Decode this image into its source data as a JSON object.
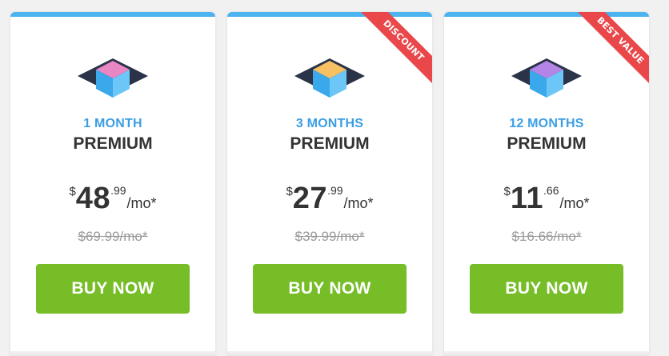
{
  "colors": {
    "accent_blue": "#4bb3ef",
    "months_text": "#3a9ee4",
    "ribbon_red": "#e9474a",
    "button_green": "#77bd28",
    "text_dark": "#333333",
    "text_muted": "#9a9a9a"
  },
  "plans": [
    {
      "months_label": "1 MONTH",
      "name": "PREMIUM",
      "currency": "$",
      "price_whole": "48",
      "price_cents": ".99",
      "per": "/mo*",
      "old_price": "$69.99/mo*",
      "button_label": "BUY NOW",
      "ribbon": "",
      "gem_color": "#e986c4",
      "icon": "premium-cube-icon"
    },
    {
      "months_label": "3 MONTHS",
      "name": "PREMIUM",
      "currency": "$",
      "price_whole": "27",
      "price_cents": ".99",
      "per": "/mo*",
      "old_price": "$39.99/mo*",
      "button_label": "BUY NOW",
      "ribbon": "DISCOUNT",
      "gem_color": "#f7c163",
      "icon": "premium-cube-icon"
    },
    {
      "months_label": "12 MONTHS",
      "name": "PREMIUM",
      "currency": "$",
      "price_whole": "11",
      "price_cents": ".66",
      "per": "/mo*",
      "old_price": "$16.66/mo*",
      "button_label": "BUY NOW",
      "ribbon": "BEST VALUE",
      "gem_color": "#b484e6",
      "icon": "premium-cube-icon"
    }
  ]
}
